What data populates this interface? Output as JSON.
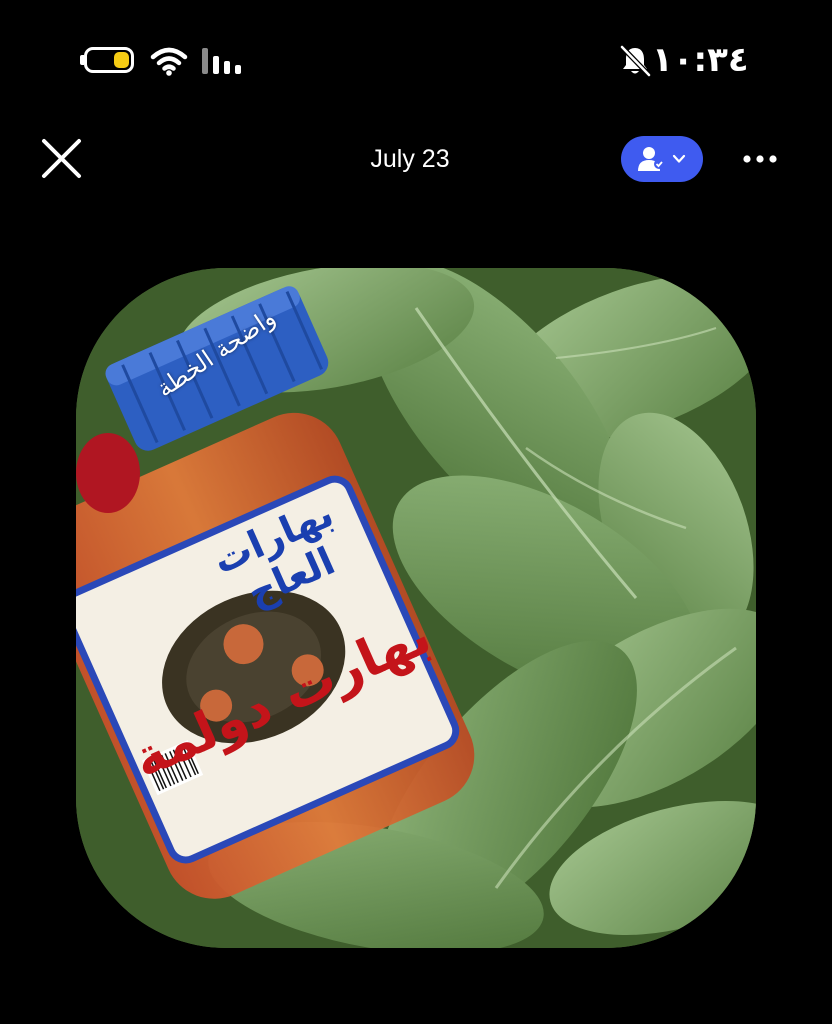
{
  "status_bar": {
    "time": "١٠:٣٤",
    "battery_icon": "battery-low-power-icon",
    "wifi_icon": "wifi-icon",
    "signal_icon": "cellular-signal-icon",
    "mute_icon": "bell-slash-icon"
  },
  "header": {
    "title": "July 23",
    "close_icon": "close-icon",
    "audience_icon": "person-icon",
    "more_icon": "more-dots-icon",
    "audience_color": "#3f5bf0"
  },
  "story": {
    "caption": "واضحة الخطة",
    "jar_brand": "بهارات العاج",
    "jar_product": "بهارت دولمة"
  }
}
